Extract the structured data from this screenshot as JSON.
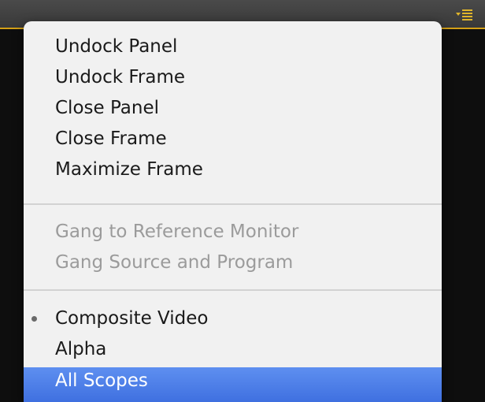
{
  "panel": {
    "accent_color": "#d4a017",
    "menu_icon": "panel-menu-icon"
  },
  "menu": {
    "groups": [
      {
        "items": [
          {
            "label": "Undock Panel",
            "enabled": true
          },
          {
            "label": "Undock Frame",
            "enabled": true
          },
          {
            "label": "Close Panel",
            "enabled": true
          },
          {
            "label": "Close Frame",
            "enabled": true
          },
          {
            "label": "Maximize Frame",
            "enabled": true
          }
        ]
      },
      {
        "items": [
          {
            "label": "Gang to Reference Monitor",
            "enabled": false
          },
          {
            "label": "Gang Source and Program",
            "enabled": false
          }
        ]
      },
      {
        "items": [
          {
            "label": "Composite Video",
            "enabled": true,
            "checked": true
          },
          {
            "label": "Alpha",
            "enabled": true
          },
          {
            "label": "All Scopes",
            "enabled": true,
            "highlighted": true
          }
        ]
      }
    ],
    "highlight_color": "#4a7ae8"
  }
}
